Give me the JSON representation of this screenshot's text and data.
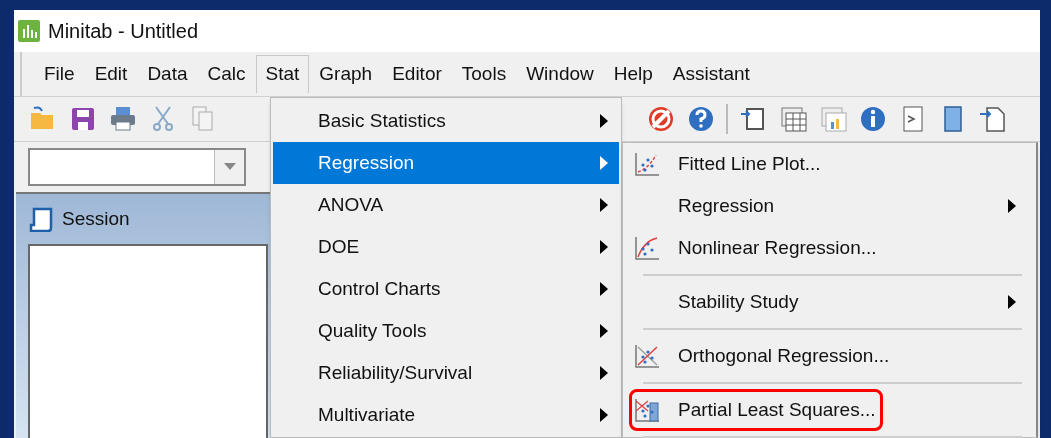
{
  "window": {
    "title": "Minitab - Untitled"
  },
  "menu_bar": [
    {
      "label": "File",
      "selected": false
    },
    {
      "label": "Edit",
      "selected": false
    },
    {
      "label": "Data",
      "selected": false
    },
    {
      "label": "Calc",
      "selected": false
    },
    {
      "label": "Stat",
      "selected": true
    },
    {
      "label": "Graph",
      "selected": false
    },
    {
      "label": "Editor",
      "selected": false
    },
    {
      "label": "Tools",
      "selected": false
    },
    {
      "label": "Window",
      "selected": false
    },
    {
      "label": "Help",
      "selected": false
    },
    {
      "label": "Assistant",
      "selected": false
    }
  ],
  "session": {
    "title": "Session"
  },
  "stat_menu": [
    {
      "label": "Basic Statistics",
      "selected": false
    },
    {
      "label": "Regression",
      "selected": true
    },
    {
      "label": "ANOVA",
      "selected": false
    },
    {
      "label": "DOE",
      "selected": false
    },
    {
      "label": "Control Charts",
      "selected": false
    },
    {
      "label": "Quality Tools",
      "selected": false
    },
    {
      "label": "Reliability/Survival",
      "selected": false
    },
    {
      "label": "Multivariate",
      "selected": false
    }
  ],
  "regression_menu": [
    {
      "kind": "command",
      "label": "Fitted Line Plot...",
      "highlighted": false
    },
    {
      "kind": "submenu",
      "label": "Regression",
      "highlighted": false
    },
    {
      "kind": "command",
      "label": "Nonlinear Regression...",
      "highlighted": false
    },
    {
      "kind": "separator"
    },
    {
      "kind": "submenu",
      "label": "Stability Study",
      "highlighted": false
    },
    {
      "kind": "separator"
    },
    {
      "kind": "command",
      "label": "Orthogonal Regression...",
      "highlighted": false
    },
    {
      "kind": "separator"
    },
    {
      "kind": "command",
      "label": "Partial Least Squares...",
      "highlighted": true
    },
    {
      "kind": "separator"
    }
  ]
}
